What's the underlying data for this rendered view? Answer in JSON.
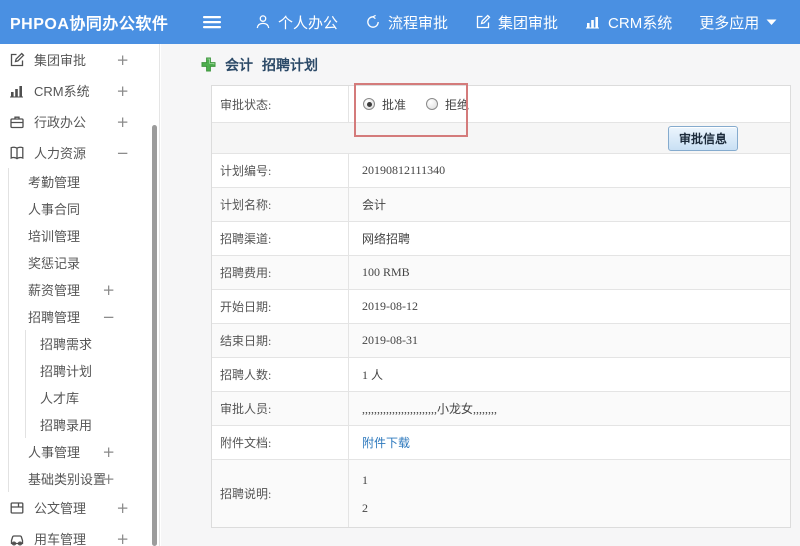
{
  "topbar": {
    "brand": "PHPOA协同办公软件",
    "nav": [
      {
        "label": "个人办公",
        "icon": "user-icon"
      },
      {
        "label": "流程审批",
        "icon": "process-icon"
      },
      {
        "label": "集团审批",
        "icon": "edit-icon"
      },
      {
        "label": "CRM系统",
        "icon": "chart-icon"
      },
      {
        "label": "更多应用",
        "icon": null,
        "caret": true
      }
    ]
  },
  "sidebar": {
    "items": [
      {
        "label": "集团审批",
        "icon": "edit-icon",
        "toggle": "+",
        "level": 0
      },
      {
        "label": "CRM系统",
        "icon": "chart-icon",
        "toggle": "+",
        "level": 0
      },
      {
        "label": "行政办公",
        "icon": "briefcase-icon",
        "toggle": "+",
        "level": 0
      },
      {
        "label": "人力资源",
        "icon": "book-icon",
        "toggle": "−",
        "level": 0
      },
      {
        "label": "考勤管理",
        "level": 1
      },
      {
        "label": "人事合同",
        "level": 1
      },
      {
        "label": "培训管理",
        "level": 1
      },
      {
        "label": "奖惩记录",
        "level": 1
      },
      {
        "label": "薪资管理",
        "toggle": "+",
        "level": 1
      },
      {
        "label": "招聘管理",
        "toggle": "−",
        "level": 1
      },
      {
        "label": "招聘需求",
        "level": 2
      },
      {
        "label": "招聘计划",
        "level": 2
      },
      {
        "label": "人才库",
        "level": 2
      },
      {
        "label": "招聘录用",
        "level": 2
      },
      {
        "label": "人事管理",
        "toggle": "+",
        "level": 1
      },
      {
        "label": "基础类别设置",
        "toggle": "+",
        "level": 1
      },
      {
        "label": "公文管理",
        "icon": "doc-icon",
        "toggle": "+",
        "level": 0
      },
      {
        "label": "用车管理",
        "icon": "car-icon",
        "toggle": "+",
        "level": 0
      }
    ]
  },
  "main": {
    "title": {
      "plan_name": "会计",
      "page_type": "招聘计划"
    },
    "approval": {
      "label": "审批状态:",
      "options": [
        {
          "label": "批准",
          "selected": true
        },
        {
          "label": "拒绝",
          "selected": false
        }
      ]
    },
    "approve_info_button": "审批信息",
    "fields": [
      {
        "label": "计划编号:",
        "value": "20190812111340"
      },
      {
        "label": "计划名称:",
        "value": "会计"
      },
      {
        "label": "招聘渠道:",
        "value": "网络招聘"
      },
      {
        "label": "招聘费用:",
        "value": "100 RMB"
      },
      {
        "label": "开始日期:",
        "value": "2019-08-12"
      },
      {
        "label": "结束日期:",
        "value": "2019-08-31"
      },
      {
        "label": "招聘人数:",
        "value": "1 人"
      },
      {
        "label": "审批人员:",
        "value": ",,,,,,,,,,,,,,,,,,,,,,,,,小龙女,,,,,,,,"
      },
      {
        "label": "附件文档:",
        "value": "附件下载",
        "type": "link"
      },
      {
        "label": "招聘说明:",
        "value": [
          "1",
          "2"
        ],
        "type": "multiline"
      }
    ]
  },
  "colors": {
    "topbar_blue": "#4a90e2",
    "annotation_red": "#d47b7b",
    "link_blue": "#2e79bd",
    "button_blue": "#c9e0f4"
  }
}
